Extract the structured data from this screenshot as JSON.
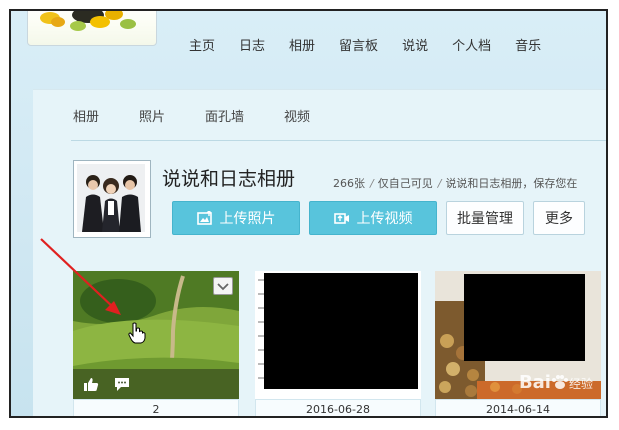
{
  "nav": {
    "items": [
      "主页",
      "日志",
      "相册",
      "留言板",
      "说说",
      "个人档",
      "音乐"
    ]
  },
  "subnav": {
    "items": [
      "相册",
      "照片",
      "面孔墙",
      "视频"
    ]
  },
  "album": {
    "title": "说说和日志相册",
    "count": "266张",
    "privacy": "仅自己可见",
    "desc": "说说和日志相册，保存您在"
  },
  "actions": {
    "upload_photo": "上传照片",
    "upload_video": "上传视频",
    "batch": "批量管理",
    "more": "更多"
  },
  "photos": [
    {
      "caption": "2"
    },
    {
      "caption": "2016-06-28"
    },
    {
      "caption": "2014-06-14"
    }
  ],
  "watermark": {
    "brand": "Bai",
    "suffix": "经验"
  },
  "colors": {
    "primary_button": "#58c4dc",
    "annotation_arrow": "#e02020"
  },
  "icons": [
    "like-icon",
    "comment-icon",
    "chevron-down-icon",
    "upload-photo-icon",
    "upload-video-icon",
    "hand-cursor-icon",
    "arrow-annotation"
  ]
}
